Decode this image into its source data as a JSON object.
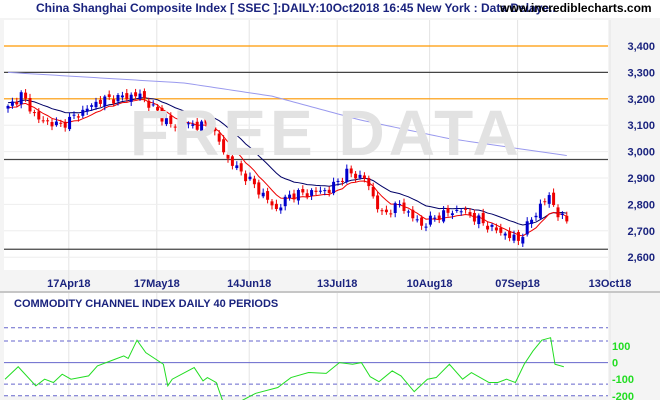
{
  "header": {
    "title": "China Shanghai Composite Index [ SSEC ]:DAILY:10Oct2018 16:45 New York : Data Delaye..",
    "site": "www.incrediblecharts.com"
  },
  "watermark": "FREE DATA",
  "chart_data": [
    {
      "type": "candlestick",
      "title": "China Shanghai Composite Index [ SSEC ] Daily",
      "ylim": [
        2560,
        3460
      ],
      "y_ticks": [
        2600,
        2700,
        2800,
        2900,
        3000,
        3100,
        3200,
        3300,
        3400
      ],
      "y_tick_labels": [
        "2,600",
        "2,700",
        "2,800",
        "2,900",
        "3,000",
        "3,100",
        "3,200",
        "3,300",
        "3,400"
      ],
      "x_tick_labels": [
        {
          "day": 7,
          "label": "17Apr18"
        },
        {
          "day": 27,
          "label": "17May18"
        },
        {
          "day": 48,
          "label": "14Jun18"
        },
        {
          "day": 68,
          "label": "13Jul18"
        },
        {
          "day": 89,
          "label": "10Aug18"
        },
        {
          "day": 109,
          "label": "07Sep18"
        },
        {
          "day": 130,
          "label": "13Oct18"
        }
      ],
      "horizontal_lines": [
        {
          "value": 3400,
          "color": "#ff9900"
        },
        {
          "value": 3300,
          "color": "#444444"
        },
        {
          "value": 3200,
          "color": "#ff9900"
        },
        {
          "value": 2970,
          "color": "#444444"
        },
        {
          "value": 2630,
          "color": "#444444"
        }
      ],
      "close_keypoints": [
        [
          0,
          3165
        ],
        [
          3,
          3215
        ],
        [
          7,
          3120
        ],
        [
          12,
          3100
        ],
        [
          21,
          3195
        ],
        [
          30,
          3215
        ],
        [
          37,
          3100
        ],
        [
          46,
          3100
        ],
        [
          50,
          2970
        ],
        [
          55,
          2890
        ],
        [
          61,
          2780
        ],
        [
          64,
          2835
        ],
        [
          73,
          2855
        ],
        [
          77,
          2920
        ],
        [
          81,
          2900
        ],
        [
          85,
          2760
        ],
        [
          89,
          2800
        ],
        [
          94,
          2720
        ],
        [
          98,
          2760
        ],
        [
          103,
          2780
        ],
        [
          110,
          2710
        ],
        [
          116,
          2665
        ],
        [
          120,
          2770
        ],
        [
          123,
          2835
        ],
        [
          125,
          2760
        ],
        [
          127,
          2740
        ]
      ],
      "long_ma_keypoints": [
        [
          0,
          3300
        ],
        [
          40,
          3260
        ],
        [
          60,
          3210
        ],
        [
          80,
          3120
        ],
        [
          100,
          3050
        ],
        [
          127,
          2985
        ]
      ],
      "colors": {
        "up": "#0000cc",
        "down": "#ee0000",
        "ma_short": "#ee0000",
        "ma_mid": "#000066",
        "ma_long": "#9999ee"
      }
    },
    {
      "type": "line",
      "title": "COMMODITY CHANNEL INDEX DAILY 40 PERIODS",
      "ylim": [
        -300,
        260
      ],
      "y_ticks": [
        100,
        0,
        -100,
        -200
      ],
      "y_tick_labels": [
        "100",
        "0",
        "-100",
        "-200"
      ],
      "dashed_levels": [
        210,
        130,
        -130,
        -200
      ],
      "keypoints": [
        [
          0,
          -100
        ],
        [
          3,
          -25
        ],
        [
          7,
          -140
        ],
        [
          9,
          -100
        ],
        [
          11,
          -120
        ],
        [
          13,
          -70
        ],
        [
          15,
          -100
        ],
        [
          19,
          -80
        ],
        [
          21,
          -20
        ],
        [
          25,
          20
        ],
        [
          27,
          40
        ],
        [
          28,
          25
        ],
        [
          30,
          135
        ],
        [
          32,
          60
        ],
        [
          36,
          -10
        ],
        [
          37,
          -140
        ],
        [
          38,
          -100
        ],
        [
          43,
          -30
        ],
        [
          45,
          -110
        ],
        [
          46,
          -90
        ],
        [
          48,
          -120
        ],
        [
          50,
          -270
        ],
        [
          53,
          -240
        ],
        [
          57,
          -185
        ],
        [
          62,
          -150
        ],
        [
          65,
          -90
        ],
        [
          69,
          -60
        ],
        [
          73,
          -65
        ],
        [
          76,
          0
        ],
        [
          79,
          -10
        ],
        [
          81,
          0
        ],
        [
          83,
          -85
        ],
        [
          85,
          -115
        ],
        [
          88,
          -50
        ],
        [
          90,
          -80
        ],
        [
          93,
          -175
        ],
        [
          96,
          -100
        ],
        [
          98,
          -90
        ],
        [
          101,
          -10
        ],
        [
          104,
          -100
        ],
        [
          106,
          -60
        ],
        [
          110,
          -120
        ],
        [
          112,
          -120
        ],
        [
          114,
          -100
        ],
        [
          116,
          -120
        ],
        [
          118,
          -10
        ],
        [
          120,
          70
        ],
        [
          122,
          135
        ],
        [
          124,
          150
        ],
        [
          125,
          -10
        ],
        [
          127,
          -25
        ]
      ],
      "color": "#22dd22"
    }
  ]
}
